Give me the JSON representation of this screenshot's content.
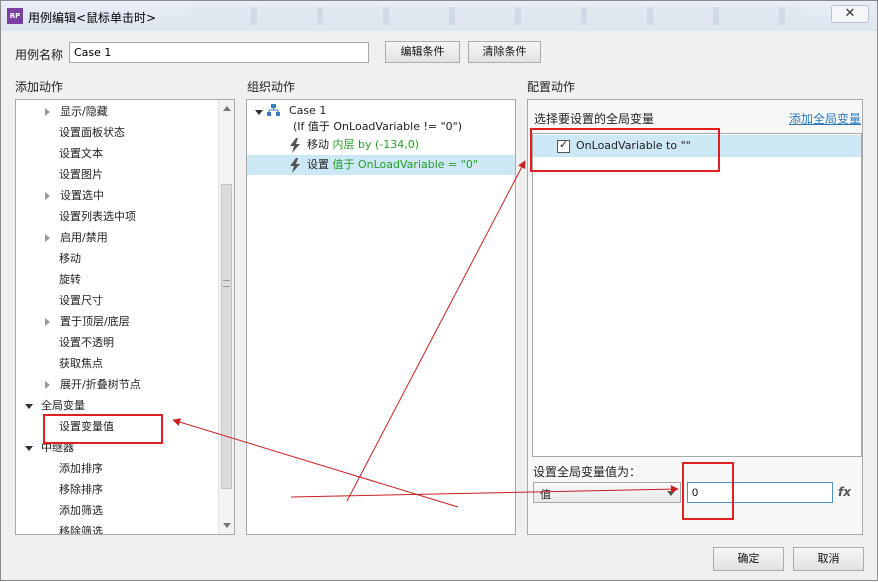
{
  "window": {
    "title": "用例编辑<鼠标单击时>",
    "app_badge": "RP",
    "close_symbol": "✕"
  },
  "case_name": {
    "label": "用例名称",
    "value": "Case 1"
  },
  "toolbar": {
    "edit_condition": "编辑条件",
    "clear_condition": "清除条件"
  },
  "add_actions": {
    "header": "添加动作",
    "items": [
      {
        "label": "显示/隐藏",
        "expandable": true
      },
      {
        "label": "设置面板状态",
        "expandable": false
      },
      {
        "label": "设置文本",
        "expandable": false
      },
      {
        "label": "设置图片",
        "expandable": false
      },
      {
        "label": "设置选中",
        "expandable": true
      },
      {
        "label": "设置列表选中项",
        "expandable": false
      },
      {
        "label": "启用/禁用",
        "expandable": true
      },
      {
        "label": "移动",
        "expandable": false
      },
      {
        "label": "旋转",
        "expandable": false
      },
      {
        "label": "设置尺寸",
        "expandable": false
      },
      {
        "label": "置于顶层/底层",
        "expandable": true
      },
      {
        "label": "设置不透明",
        "expandable": false
      },
      {
        "label": "获取焦点",
        "expandable": false
      },
      {
        "label": "展开/折叠树节点",
        "expandable": true
      }
    ],
    "group_global_var": "全局变量",
    "set_var_value": "设置变量值",
    "group_repeater": "中继器",
    "repeater_items": [
      "添加排序",
      "移除排序",
      "添加筛选",
      "移除筛选"
    ]
  },
  "organize_actions": {
    "header": "组织动作",
    "case_label": "Case 1",
    "case_condition": "(If 值于 OnLoadVariable != \"0\")",
    "action1_verb": "移动",
    "action1_detail": "内层 by (-134,0)",
    "action2_verb": "设置",
    "action2_detail": "值于 OnLoadVariable = \"0\""
  },
  "configure_actions": {
    "header": "配置动作",
    "select_var_label": "选择要设置的全局变量",
    "add_global_var_link": "添加全局变量",
    "var_item": "OnLoadVariable to \"\"",
    "set_value_label": "设置全局变量值为：",
    "value_type": "值",
    "value": "0",
    "fx": "fx"
  },
  "footer": {
    "ok": "确定",
    "cancel": "取消"
  },
  "colors": {
    "annotation_red": "#e02020",
    "selection_blue": "#cde8f5",
    "link_blue": "#2a7ab8",
    "green_text": "#2a9a2a"
  }
}
